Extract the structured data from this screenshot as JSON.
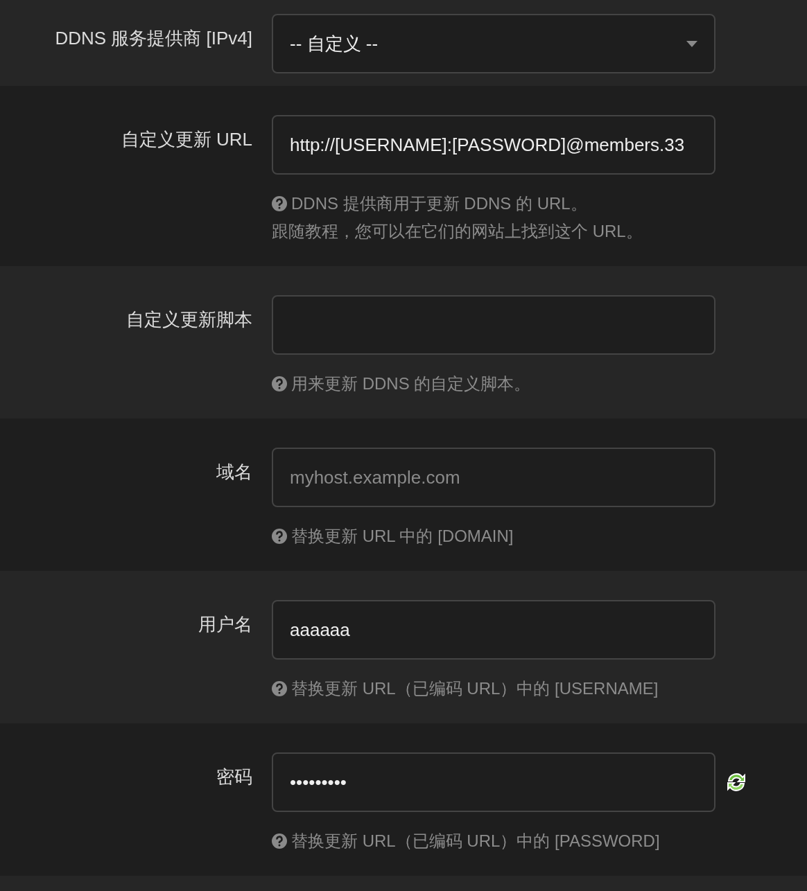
{
  "fields": [
    {
      "kind": "select",
      "label": "DDNS 服务提供商 [IPv4]",
      "value": "-- 自定义 --"
    },
    {
      "kind": "text",
      "label": "自定义更新 URL",
      "value": "http://[USERNAME]:[PASSWORD]@members.33",
      "help": [
        "DDNS 提供商用于更新 DDNS 的 URL。",
        "跟随教程，您可以在它们的网站上找到这个 URL。"
      ]
    },
    {
      "kind": "text",
      "label": "自定义更新脚本",
      "help": [
        "用来更新 DDNS 的自定义脚本。"
      ]
    },
    {
      "kind": "text",
      "label": "域名",
      "placeholder": "myhost.example.com",
      "help": [
        "替换更新 URL 中的 [DOMAIN]"
      ]
    },
    {
      "kind": "text",
      "label": "用户名",
      "value": "aaaaaa",
      "help": [
        "替换更新 URL（已编码 URL）中的 [USERNAME]"
      ]
    },
    {
      "kind": "password",
      "label": "密码",
      "value": "•••••••••",
      "help": [
        "替换更新 URL（已编码 URL）中的 [PASSWORD]"
      ]
    }
  ]
}
